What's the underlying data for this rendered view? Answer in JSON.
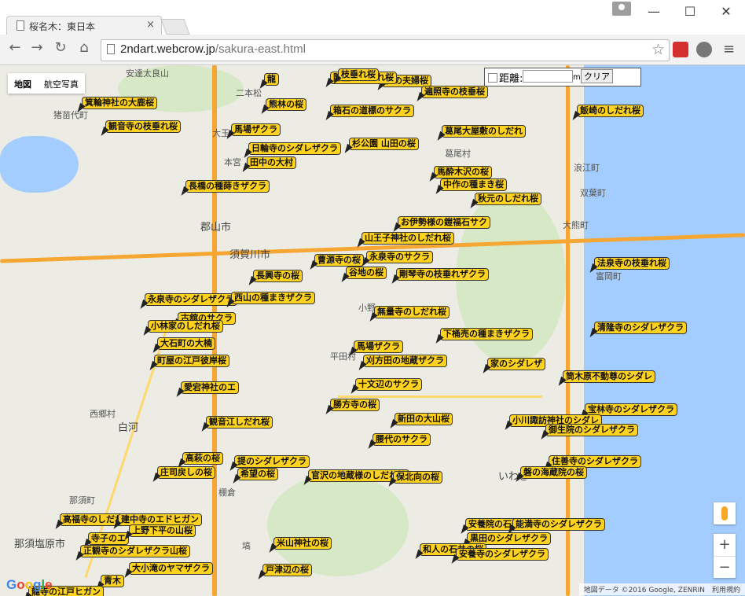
{
  "browser": {
    "tab_title": "桜名木：東日本",
    "tab_close": "×",
    "window": {
      "minimize": "—",
      "maximize": "☐",
      "close": "✕"
    },
    "nav": {
      "back": "←",
      "forward": "→",
      "reload": "↻",
      "home": "⌂"
    },
    "url_host": "2ndart.webcrow.jp",
    "url_path": "/sakura-east.html",
    "star": "☆",
    "menu": "≡"
  },
  "map": {
    "type_control": [
      "地図",
      "航空写真"
    ],
    "distance_tool": {
      "label": "距離:",
      "unit": "m",
      "clear": "クリア",
      "value": ""
    },
    "zoom_in": "+",
    "zoom_out": "−",
    "google_logo": "Google",
    "credits": "地図データ ©2016 Google, ZENRIN　利用規約",
    "places": [
      "安達太良山",
      "猪苗代町",
      "本宮",
      "大玉",
      "郡山市",
      "須賀川市",
      "白河",
      "西郷村",
      "那須町",
      "那須塩原市",
      "平田村",
      "小野",
      "いわき",
      "富岡町",
      "浪江町",
      "双葉町",
      "大熊町",
      "葛尾村",
      "二本松",
      "塙",
      "棚倉"
    ],
    "markers": [
      "龍",
      "社の夫婦桜",
      "陣屋のしだれ桜",
      "遍照寺の枝垂桜",
      "枝垂れ桜",
      "箕輪神社の大鹿桜",
      "飯崎のしだれ桜",
      "観音寺の枝垂れ桜",
      "馬場ザクラ",
      "熊林の桜",
      "箱石の道標のサクラ",
      "葛尾大屋敷のしだれ",
      "日輪寺のシダレザクラ",
      "田中の大村",
      "杉公園 山田の桜",
      "馬酔木沢の桜",
      "中作の種まき桜",
      "長橋の種蒔きザクラ",
      "秋元のしだれ桜",
      "お伊勢様の鎧福石サク",
      "山王子神社のしだれ桜",
      "曹源寺の桜",
      "永泉寺のサクラ",
      "法泉寺の枝垂れ桜",
      "長興寺の桜",
      "谷地の桜",
      "剛琴寺の枝垂れザクラ",
      "永泉寺のシダレザクラ",
      "西山の種まきザクラ",
      "無量寺のしだれ桜",
      "古舘のサクラ",
      "小林家のしだれ桜",
      "清隆寺のシダレザクラ",
      "下桶売の種まきザクラ",
      "大石町の大楠",
      "馬場ザクラ",
      "町屋の江戸彼岸桜",
      "刈方田の地蔵ザクラ",
      "家のシダレザ",
      "筒木原不動尊のシダレ",
      "愛宕神社のエ",
      "十文辺のサクラ",
      "宝林寺のシダレザクラ",
      "小川諏訪神社のシダレ",
      "御生院のシダレザクラ",
      "新田の大山桜",
      "観音江しだれ桜",
      "勝方寺の桜",
      "高萩の桜",
      "腰代のサクラ",
      "提のシダレザクラ",
      "住善寺のシダレザクラ",
      "希望の桜",
      "磐の海蔵院の桜",
      "庄司戻しの桜",
      "官沢の地蔵様のしだれ桜",
      "保北向の桜",
      "高福寺のしだれ",
      "建中寺のエドヒガン",
      "安養院の石近桜",
      "能満寺のシダレザクラ",
      "寺子のエ",
      "上野下平の山桜",
      "米山神社の桜",
      "黒田のシダレザクラ",
      "正観寺のシダレザクラ山桜",
      "和人の石井の桜",
      "大小滝のヤマザクラ",
      "戸津辺の桜",
      "青木",
      "龍寺の江戸ヒガン",
      "安養寺のシダレザクラ"
    ]
  }
}
